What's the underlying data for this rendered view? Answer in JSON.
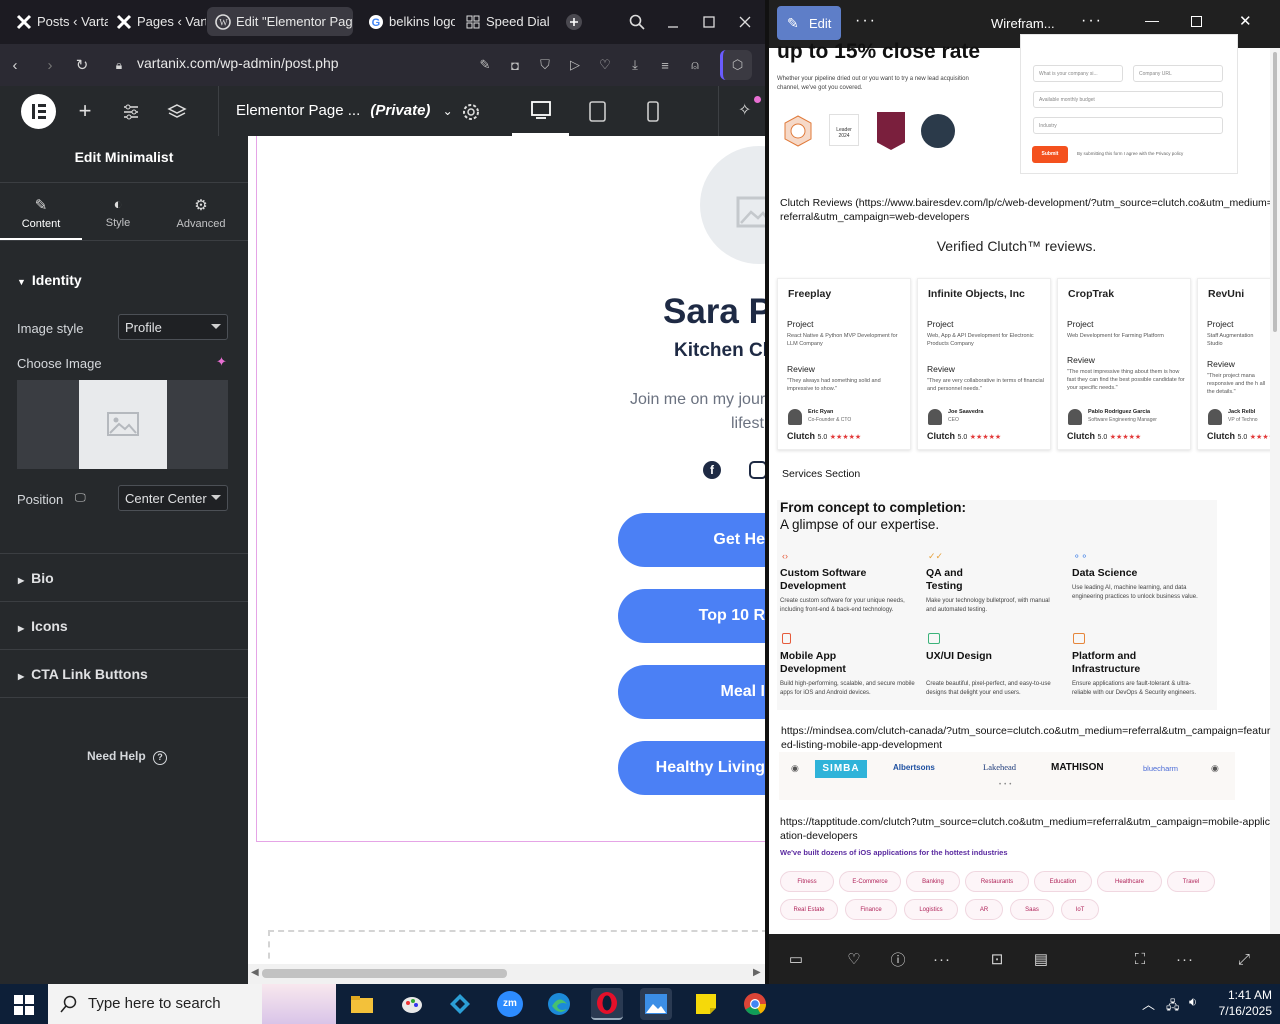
{
  "browser": {
    "tabs": [
      {
        "label": "Posts ‹ Vartan"
      },
      {
        "label": "Pages ‹ Varta"
      },
      {
        "label": "Edit \"Elementor Page"
      },
      {
        "label": "belkins logo"
      },
      {
        "label": "Speed Dial"
      }
    ],
    "url": "vartanix.com/wp-admin/post.php"
  },
  "elementor": {
    "page_title": "Elementor Page ...",
    "page_status": "(Private)",
    "panel_title": "Edit Minimalist",
    "tabs": {
      "content": "Content",
      "style": "Style",
      "advanced": "Advanced"
    },
    "identity": {
      "section": "Identity",
      "image_style_label": "Image style",
      "image_style_value": "Profile",
      "choose_image_label": "Choose Image",
      "position_label": "Position",
      "position_value": "Center Center"
    },
    "sections": {
      "bio": "Bio",
      "icons": "Icons",
      "cta": "CTA Link Buttons"
    },
    "need_help": "Need Help"
  },
  "canvas": {
    "name": "Sara P",
    "role": "Kitchen Cl",
    "bio_line1": "Join me on my jour",
    "bio_line2": "lifest",
    "buttons": [
      "Get He",
      "Top 10 R",
      "Meal I",
      "Healthy Living"
    ]
  },
  "viewer": {
    "edit_label": "Edit",
    "title": "Wirefram...",
    "headline": "up to 15% close rate",
    "intro": "Whether your pipeline dried out or you want to try a new lead acquisition channel, we've got you covered.",
    "form_fields": [
      "What is your company si...",
      "Company URL",
      "Available monthly budget",
      "Industry"
    ],
    "submit": "Submit",
    "consent": "By submitting this form I agree with the Privacy policy",
    "badges": [
      "Leader 2024"
    ],
    "clutch_url_1": "Clutch Reviews (https://www.bairesdev.com/lp/c/web-development/?utm_source=clutch.co&utm_medium=referral&utm_campaign=web-developers",
    "clutch_heading": "Verified Clutch™ reviews.",
    "cards": [
      {
        "company": "Freeplay",
        "project_label": "Project",
        "project": "React Native & Python MVP Development for LLM Company",
        "review_label": "Review",
        "review": "\"They always had something solid and impressive to show.\"",
        "reviewer": "Eric Ryan",
        "role": "Co-Founder & CTO",
        "score": "5.0"
      },
      {
        "company": "Infinite Objects, Inc",
        "project_label": "Project",
        "project": "Web, App & API Development for Electronic Products Company",
        "review_label": "Review",
        "review": "\"They are very collaborative in terms of financial and personnel needs.\"",
        "reviewer": "Joe Saavedra",
        "role": "CEO",
        "score": "5.0"
      },
      {
        "company": "CropTrak",
        "project_label": "Project",
        "project": "Web Development for Farming Platform",
        "review_label": "Review",
        "review": "\"The most impressive thing about them is how fast they can find the best possible candidate for your specific needs.\"",
        "reviewer": "Pablo Rodriguez Garcia",
        "role": "Software Engineering Manager",
        "score": "5.0"
      },
      {
        "company": "RevUni",
        "project_label": "Project",
        "project": "Staff Augmentation Studio",
        "review_label": "Review",
        "review": "\"Their project mana responsive and the h all the details.\"",
        "reviewer": "Jack Relbl",
        "role": "VP of Techno",
        "score": "5.0"
      }
    ],
    "clutch_brand": "Clutch",
    "stars": "★★★★★",
    "services_label": "Services Section",
    "services_heading_1": "From concept to completion:",
    "services_heading_2": "A glimpse of our expertise.",
    "services": [
      {
        "title": "Custom Software Development",
        "desc": "Create custom software for your unique needs, including front-end & back-end technology."
      },
      {
        "title": "QA and Testing",
        "desc": "Make your technology bulletproof, with manual and automated testing."
      },
      {
        "title": "Data Science",
        "desc": "Use leading AI, machine learning, and data engineering practices to unlock business value."
      },
      {
        "title": "Mobile App Development",
        "desc": "Build high-performing, scalable, and secure mobile apps for iOS and Android devices."
      },
      {
        "title": "UX/UI Design",
        "desc": "Create beautiful, pixel-perfect, and easy-to-use designs that delight your end users."
      },
      {
        "title": "Platform and Infrastructure",
        "desc": "Ensure applications are fault-tolerant & ultra-reliable with our DevOps & Security engineers."
      }
    ],
    "mindsea_url": "https://mindsea.com/clutch-canada/?utm_source=clutch.co&utm_medium=referral&utm_campaign=featured-listing-mobile-app-development",
    "logos": [
      "SIMBA",
      "Albertsons",
      "Lakehead",
      "MATHISON",
      "bluecharm"
    ],
    "tapptitude_url": "https://tapptitude.com/clutch?utm_source=clutch.co&utm_medium=referral&utm_campaign=mobile-application-developers",
    "ios_heading": "We've built dozens of iOS applications for the hottest industries",
    "industries": [
      "Fitness",
      "E-Commerce",
      "Banking",
      "Restaurants",
      "Education",
      "Healthcare",
      "Travel",
      "Real Estate",
      "Finance",
      "Logistics",
      "AR",
      "Saas",
      "IoT"
    ]
  },
  "taskbar": {
    "search_placeholder": "Type here to search",
    "time": "1:41 AM",
    "date": "7/16/2025"
  },
  "colors": {
    "accent_blue": "#4b80f5",
    "elementor_dark": "#26292c",
    "submit_orange": "#f4511e"
  }
}
